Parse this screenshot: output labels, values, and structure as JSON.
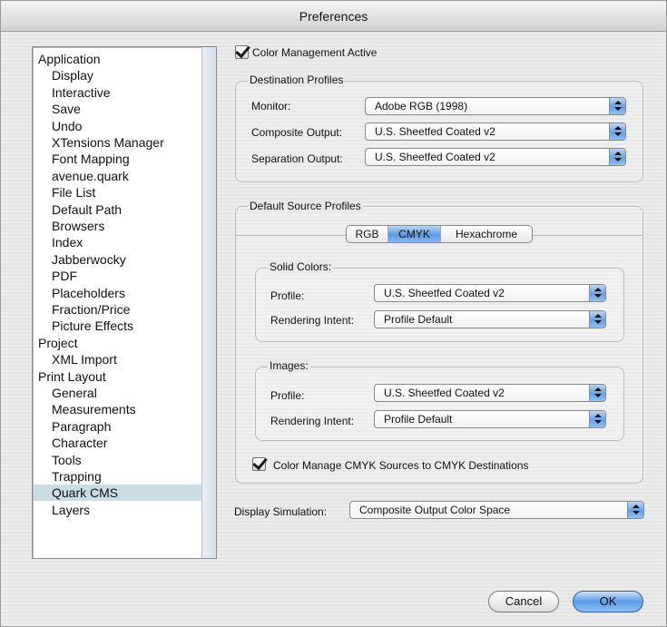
{
  "window": {
    "title": "Preferences"
  },
  "sidebar": {
    "items": [
      {
        "label": "Application",
        "level": "cat"
      },
      {
        "label": "Display",
        "level": "sub"
      },
      {
        "label": "Interactive",
        "level": "sub"
      },
      {
        "label": "Save",
        "level": "sub"
      },
      {
        "label": "Undo",
        "level": "sub"
      },
      {
        "label": "XTensions Manager",
        "level": "sub"
      },
      {
        "label": "Font Mapping",
        "level": "sub"
      },
      {
        "label": "avenue.quark",
        "level": "sub"
      },
      {
        "label": "File List",
        "level": "sub"
      },
      {
        "label": "Default Path",
        "level": "sub"
      },
      {
        "label": "Browsers",
        "level": "sub"
      },
      {
        "label": "Index",
        "level": "sub"
      },
      {
        "label": "Jabberwocky",
        "level": "sub"
      },
      {
        "label": "PDF",
        "level": "sub"
      },
      {
        "label": "Placeholders",
        "level": "sub"
      },
      {
        "label": "Fraction/Price",
        "level": "sub"
      },
      {
        "label": "Picture Effects",
        "level": "sub"
      },
      {
        "label": "Project",
        "level": "cat"
      },
      {
        "label": "XML Import",
        "level": "sub"
      },
      {
        "label": "Print Layout",
        "level": "cat"
      },
      {
        "label": "General",
        "level": "sub"
      },
      {
        "label": "Measurements",
        "level": "sub"
      },
      {
        "label": "Paragraph",
        "level": "sub"
      },
      {
        "label": "Character",
        "level": "sub"
      },
      {
        "label": "Tools",
        "level": "sub"
      },
      {
        "label": "Trapping",
        "level": "sub"
      },
      {
        "label": "Quark CMS",
        "level": "sub",
        "selected": true
      },
      {
        "label": "Layers",
        "level": "sub"
      }
    ]
  },
  "main": {
    "color_management_active": {
      "label": "Color Management Active",
      "checked": true
    },
    "destination_profiles": {
      "title": "Destination Profiles",
      "monitor": {
        "label": "Monitor:",
        "value": "Adobe RGB (1998)"
      },
      "composite_output": {
        "label": "Composite Output:",
        "value": "U.S. Sheetfed Coated v2"
      },
      "separation_output": {
        "label": "Separation Output:",
        "value": "U.S. Sheetfed Coated v2"
      }
    },
    "default_source_profiles": {
      "title": "Default Source Profiles",
      "tabs": [
        {
          "label": "RGB",
          "active": false
        },
        {
          "label": "CMYK",
          "active": true
        },
        {
          "label": "Hexachrome",
          "active": false
        }
      ],
      "solid_colors": {
        "title": "Solid Colors:",
        "profile": {
          "label": "Profile:",
          "value": "U.S. Sheetfed Coated v2"
        },
        "rendering_intent": {
          "label": "Rendering Intent:",
          "value": "Profile Default"
        }
      },
      "images": {
        "title": "Images:",
        "profile": {
          "label": "Profile:",
          "value": "U.S. Sheetfed Coated v2"
        },
        "rendering_intent": {
          "label": "Rendering Intent:",
          "value": "Profile Default"
        }
      },
      "cmyk_to_cmyk": {
        "label": "Color Manage CMYK Sources to CMYK Destinations",
        "checked": true
      }
    },
    "display_simulation": {
      "label": "Display Simulation:",
      "value": "Composite Output Color Space"
    }
  },
  "buttons": {
    "cancel": "Cancel",
    "ok": "OK"
  },
  "colors": {
    "accent": "#5e98dd",
    "selection": "#c9dde6"
  }
}
